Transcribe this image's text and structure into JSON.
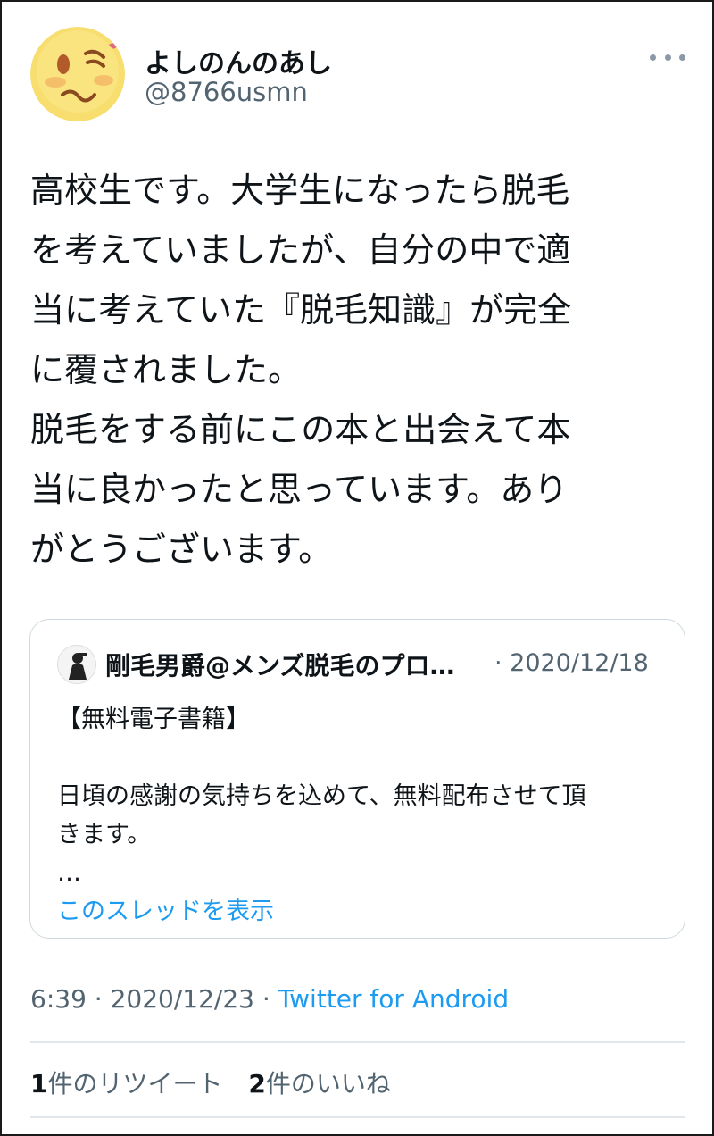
{
  "author": {
    "name": "よしのんのあし",
    "handle": "@8766usmn"
  },
  "tweet": {
    "lines": [
      "高校生です。大学生になったら脱毛",
      "を考えていましたが、自分の中で適",
      "当に考えていた『脱毛知識』が完全",
      "に覆されました。",
      "脱毛をする前にこの本と出会えて本",
      "当に良かったと思っています。あり",
      "がとうございます。"
    ]
  },
  "quoted_tweet": {
    "name": "剛毛男爵@メンズ脱毛のプロ…",
    "date": "· 2020/12/18",
    "lines": [
      "【無料電子書籍】",
      "",
      "日頃の感謝の気持ちを込めて、無料配布させて頂",
      "きます。",
      "…"
    ],
    "show_thread": "このスレッドを表示"
  },
  "meta": {
    "time": "6:39",
    "sep1": " · ",
    "date": "2020/12/23",
    "sep2": " · ",
    "source": "Twitter for Android"
  },
  "stats": {
    "retweets_count": "1",
    "retweets_label": "件のリツイート",
    "likes_count": "2",
    "likes_label": "件のいいね"
  },
  "colors": {
    "accent": "#1d9bf0",
    "secondary_text": "#536471",
    "border": "#cfd9de",
    "avatar_face": "#f7de6e"
  }
}
